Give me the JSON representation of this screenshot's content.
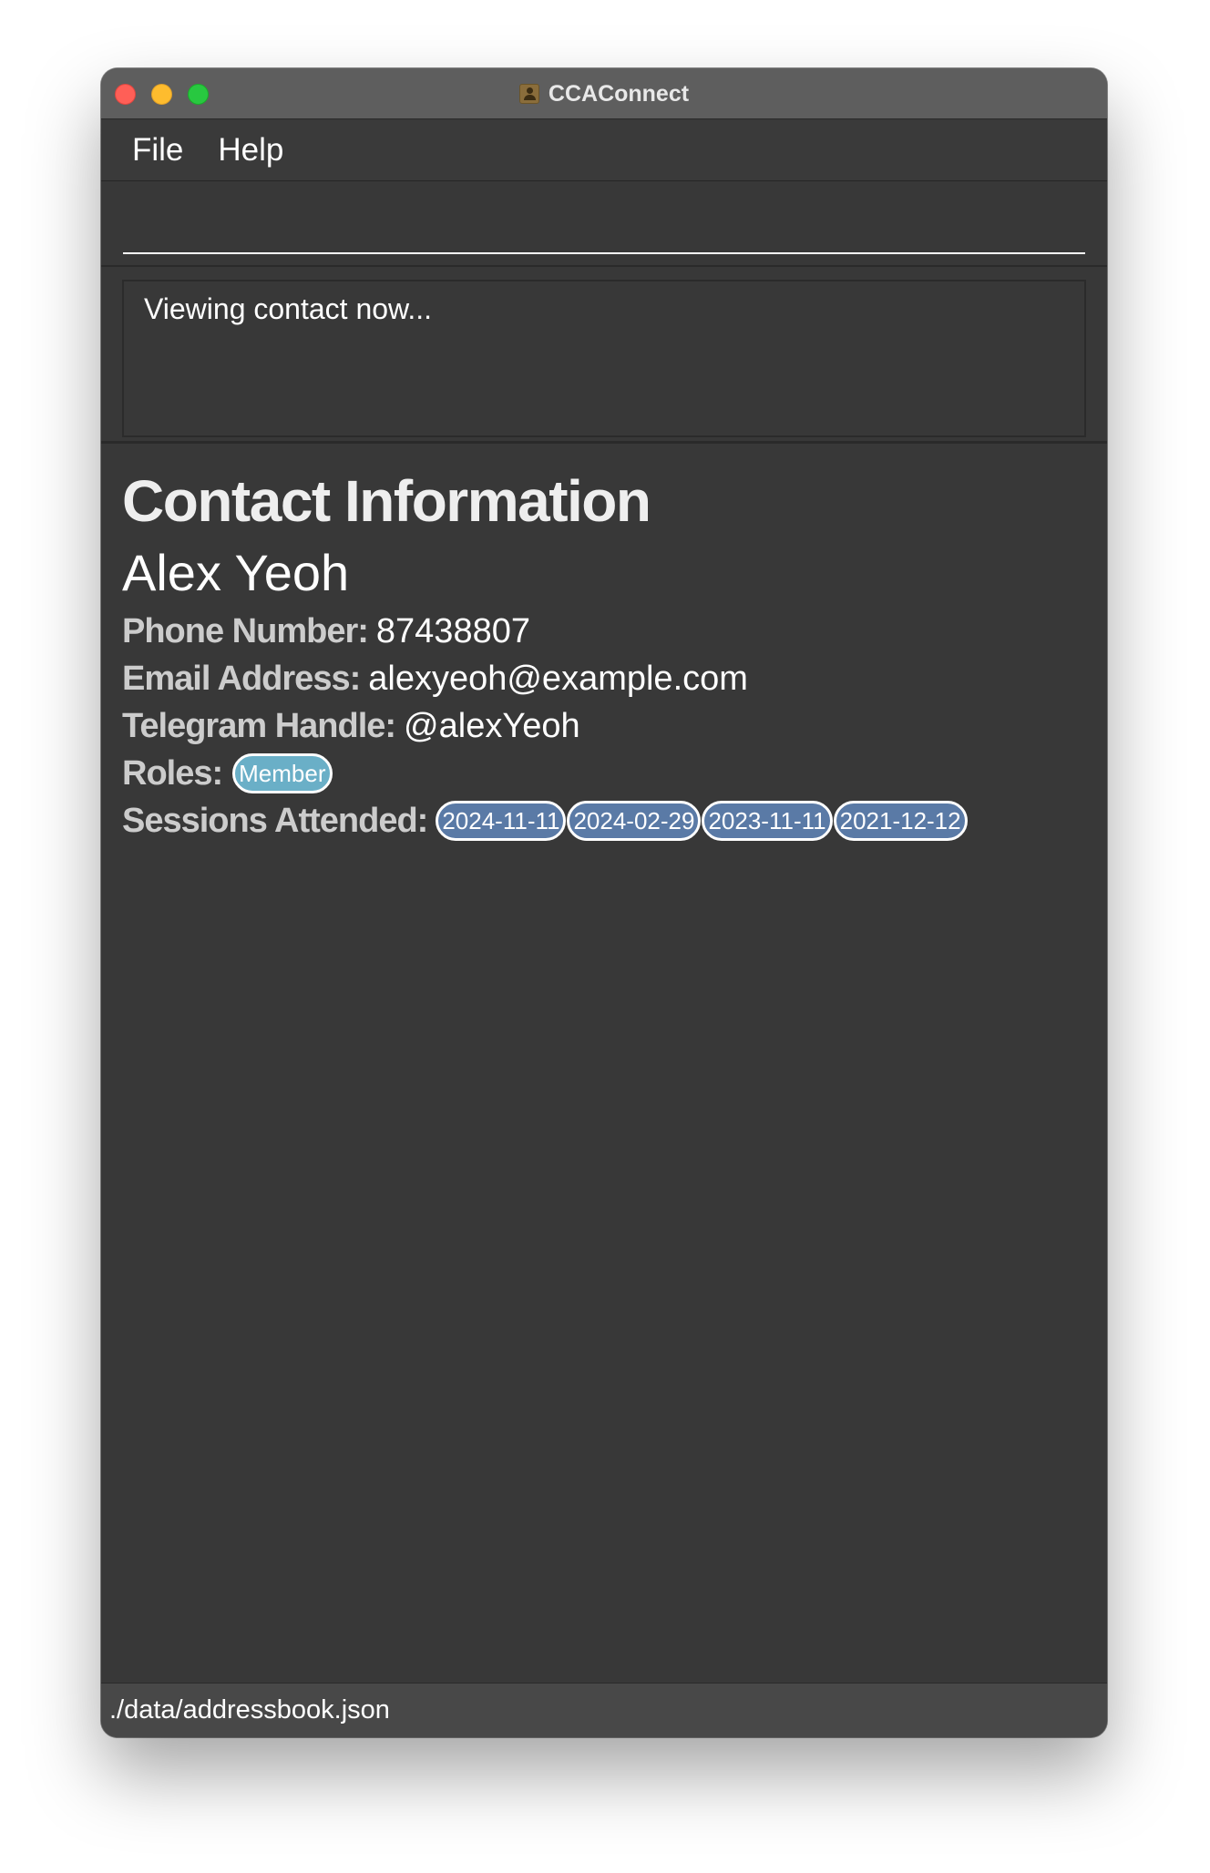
{
  "window": {
    "title": "CCAConnect",
    "app_icon": "contacts-book-icon"
  },
  "menubar": {
    "items": [
      {
        "label": "File"
      },
      {
        "label": "Help"
      }
    ]
  },
  "command_box": {
    "value": "",
    "placeholder": ""
  },
  "result_display": {
    "text": "Viewing contact now..."
  },
  "contact": {
    "heading": "Contact Information",
    "name": "Alex Yeoh",
    "phone_label": "Phone Number:",
    "phone": "87438807",
    "email_label": "Email Address:",
    "email": "alexyeoh@example.com",
    "telegram_label": "Telegram Handle:",
    "telegram": "@alexYeoh",
    "roles_label": "Roles:",
    "roles": [
      "Member"
    ],
    "sessions_label": "Sessions Attended:",
    "sessions": [
      "2024-11-11",
      "2024-02-29",
      "2023-11-11",
      "2021-12-12"
    ]
  },
  "statusbar": {
    "path": "./data/addressbook.json"
  },
  "colors": {
    "window_bg": "#383838",
    "titlebar_bg": "#5e5e5e",
    "role_tag": "#6aafc7",
    "session_tag": "#5a7aa6",
    "close": "#ff5f57",
    "minimize": "#febc2e",
    "maximize": "#28c840"
  }
}
